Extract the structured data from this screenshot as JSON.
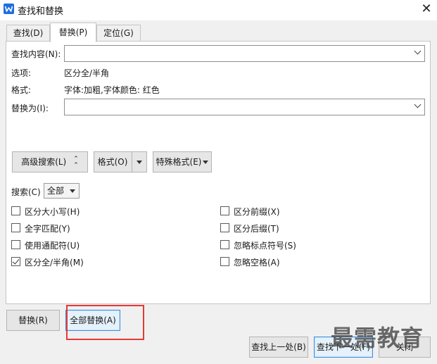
{
  "window": {
    "title": "查找和替换"
  },
  "tabs": [
    {
      "label": "查找(D)"
    },
    {
      "label": "替换(P)",
      "active": true
    },
    {
      "label": "定位(G)"
    }
  ],
  "find_field": {
    "label": "查找内容(N):",
    "value": ""
  },
  "options": {
    "label": "选项:",
    "value": "区分全/半角"
  },
  "format": {
    "label": "格式:",
    "value": "字体:加粗,字体颜色: 红色"
  },
  "replace_field": {
    "label": "替换为(I):",
    "value": ""
  },
  "buttons": {
    "advanced": "高级搜索(L)",
    "format": "格式(O)",
    "special": "特殊格式(E)"
  },
  "search": {
    "label": "搜索(C)",
    "selected": "全部"
  },
  "checkboxes_left": [
    {
      "label": "区分大小写(H)",
      "checked": false
    },
    {
      "label": "全字匹配(Y)",
      "checked": false
    },
    {
      "label": "使用通配符(U)",
      "checked": false
    },
    {
      "label": "区分全/半角(M)",
      "checked": true
    }
  ],
  "checkboxes_right": [
    {
      "label": "区分前缀(X)",
      "checked": false
    },
    {
      "label": "区分后缀(T)",
      "checked": false
    },
    {
      "label": "忽略标点符号(S)",
      "checked": false
    },
    {
      "label": "忽略空格(A)",
      "checked": false
    }
  ],
  "actions": {
    "replace": "替换(R)",
    "replace_all": "全部替换(A)",
    "find_prev": "查找上一处(B)",
    "find_next": "查找下一处(F)",
    "close": "关闭"
  },
  "watermark": "最需教育",
  "colors": {
    "app_icon": "#1e6fe0",
    "highlight_border": "#e53935",
    "focus_border": "#3a8ee6"
  }
}
